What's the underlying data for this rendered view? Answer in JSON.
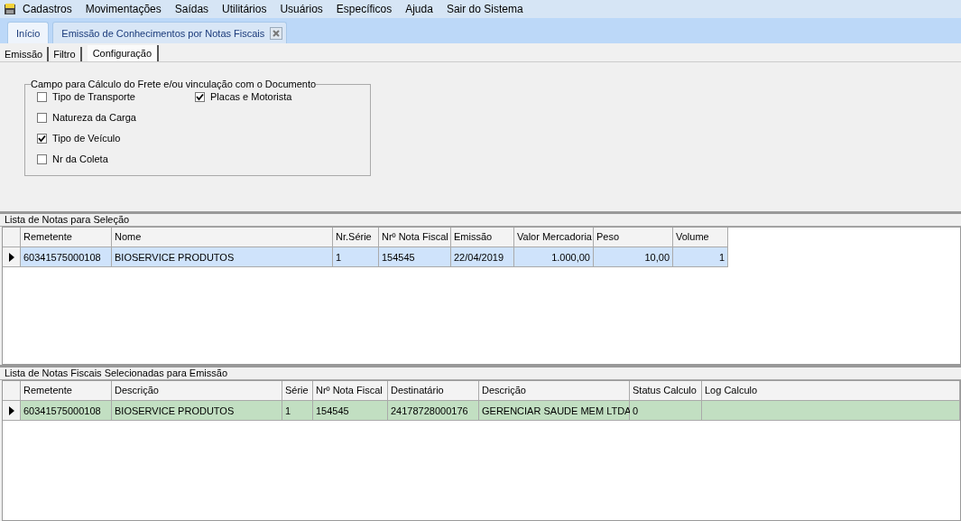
{
  "menu": [
    "Cadastros",
    "Movimentações",
    "Saídas",
    "Utilitários",
    "Usuários",
    "Específicos",
    "Ajuda",
    "Sair do Sistema"
  ],
  "tabs": [
    {
      "label": "Início",
      "selected": false,
      "closable": false
    },
    {
      "label": "Emissão de Conhecimentos por Notas Fiscais",
      "selected": true,
      "closable": true
    }
  ],
  "subtabs": [
    {
      "label": "Emissão",
      "selected": false
    },
    {
      "label": "Filtro",
      "selected": false
    },
    {
      "label": "Configuração",
      "selected": true
    }
  ],
  "config": {
    "title": "Campo para Cálculo do Frete  e/ou vinculação com o Documento",
    "columns": [
      [
        {
          "label": "Tipo de Transporte",
          "checked": false
        },
        {
          "label": "Natureza da Carga",
          "checked": false
        },
        {
          "label": "Tipo de Veículo",
          "checked": true
        },
        {
          "label": "Nr da Coleta",
          "checked": false
        }
      ],
      [
        {
          "label": "Placas e Motorista",
          "checked": true
        }
      ]
    ]
  },
  "grids": [
    {
      "title": "Lista de Notas para Seleção",
      "columns": [
        "Remetente",
        "Nome",
        "Nr.Série",
        "Nrº Nota Fiscal",
        "Emissão",
        "Valor Mercadoria",
        "Peso",
        "Volume"
      ],
      "rows": [
        {
          "selected": true,
          "cells": [
            "60341575000108",
            "BIOSERVICE PRODUTOS",
            "1",
            "154545",
            "22/04/2019",
            "1.000,00",
            "10,00",
            "1"
          ]
        }
      ]
    },
    {
      "title": "Lista de Notas Fiscais Selecionadas para Emissão",
      "columns": [
        "Remetente",
        "Descrição",
        "Série",
        "Nrº Nota Fiscal",
        "Destinatário",
        "Descrição",
        "Status Calculo",
        "Log Calculo"
      ],
      "rows": [
        {
          "selected": true,
          "cells": [
            "60341575000108",
            "BIOSERVICE PRODUTOS",
            "1",
            "154545",
            "24178728000176",
            "GERENCIAR SAUDE MEM LTDA",
            "0",
            ""
          ]
        }
      ]
    }
  ]
}
